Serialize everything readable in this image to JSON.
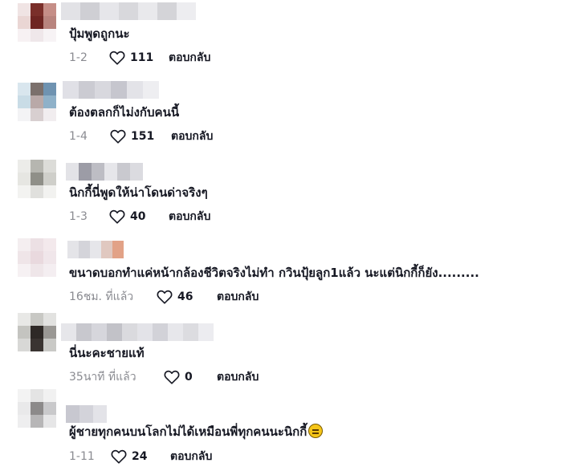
{
  "comments": [
    {
      "text": "ปุ้มพูดถูกนะ",
      "date": "1-2",
      "likes": "111",
      "reply_label": "ตอบกลับ",
      "avatar_colors": [
        "#f0e4e4",
        "#7a2f2a",
        "#c58e87",
        "#ead6d4",
        "#6e2522",
        "#b8847e",
        "#f7f1f3",
        "#efe7ea",
        "#f7f3f5"
      ],
      "username_colors": [
        "#e2e2e6",
        "#cfcfd4",
        "#e6e6ea",
        "#d8d8dc",
        "#e9e9ec",
        "#d4d4d8",
        "#ededf0"
      ]
    },
    {
      "text": "ต้องตลกก็ไม่งกับคนนี้",
      "date": "1-4",
      "likes": "151",
      "reply_label": "ตอบกลับ",
      "avatar_colors": [
        "#d9e6ee",
        "#7b706c",
        "#6f93b1",
        "#c9dce6",
        "#b9a9a8",
        "#8fb1c9",
        "#f3f3f5",
        "#d8cfd0",
        "#f1edef"
      ],
      "username_colors": [
        "#e0e0e6",
        "#cbcbd2",
        "#d8d8de",
        "#c6c6ce",
        "#e3e3e8",
        "#eeeef1"
      ]
    },
    {
      "text": "นิกกี้นี่พูดให้น่าโดนด่าจริงๆ",
      "date": "1-3",
      "likes": "40",
      "reply_label": "ตอบกลับ",
      "avatar_colors": [
        "#ecece9",
        "#b6b6b0",
        "#dcdcd8",
        "#e6e6e2",
        "#8f8f88",
        "#cfcfca",
        "#f3f3f1",
        "#e0e0dd",
        "#f2f2f0"
      ],
      "username_colors": [
        "#e3e3e7",
        "#9c9ca6",
        "#bdbdc4",
        "#e6e6ea",
        "#c9c9cf",
        "#dbdbe0"
      ]
    },
    {
      "text": "ขนาดบอกทำแค่หน้ากล้องชีวิตจริงไม่ทำ กวินปุ้ยลูก1แล้ว นะแต่นิกกี้ก็ยัง.........",
      "date": "16ชม. ที่แล้ว",
      "likes": "46",
      "reply_label": "ตอบกลับ",
      "avatar_colors": [
        "#f4eef0",
        "#ece0e4",
        "#f3e9ec",
        "#efe5e8",
        "#e9d9de",
        "#f0e6ea",
        "#f6f1f3",
        "#efe6e9",
        "#f4eef1"
      ],
      "username_colors": [
        "#e4e4e8",
        "#d4d4da",
        "#e6e6ea",
        "#e0c8c0",
        "#e2a287"
      ]
    },
    {
      "text": "นี่นะคะชายแท้",
      "date": "35นาที ที่แล้ว",
      "likes": "0",
      "reply_label": "ตอบกลับ",
      "avatar_colors": [
        "#e8e8e6",
        "#c8c8c4",
        "#e2e2e0",
        "#c4c4c0",
        "#2e2926",
        "#9a9894",
        "#d8d8d6",
        "#3a3431",
        "#c9c9c6"
      ],
      "username_colors": [
        "#e6e6ea",
        "#c8c8ce",
        "#d6d6dc",
        "#c2c2c8",
        "#dadade",
        "#e3e3e8",
        "#d2d2d8",
        "#e7e7eb",
        "#dcdce0",
        "#ececf0"
      ]
    },
    {
      "text": "ผู้ชายทุกคนบนโลกไม่ได้เหมือนพี่ทุกคนนะนิกกี้",
      "date": "1-11",
      "likes": "24",
      "reply_label": "ตอบกลับ",
      "avatar_colors": [
        "#f3f3f3",
        "#e4e4e4",
        "#f1f1f1",
        "#e9e9ea",
        "#8c8a8a",
        "#c9c9cb",
        "#eeeeef",
        "#b7b6b7",
        "#e6e6e7"
      ],
      "username_colors": [
        "#c8c8d0",
        "#d3d3da",
        "#e3e3e8"
      ]
    }
  ],
  "icons": {
    "like": "heart-outline-icon",
    "emoji": "expressionless-face-emoji"
  },
  "colors": {
    "text": "#161823",
    "muted": "#8a8b91"
  }
}
